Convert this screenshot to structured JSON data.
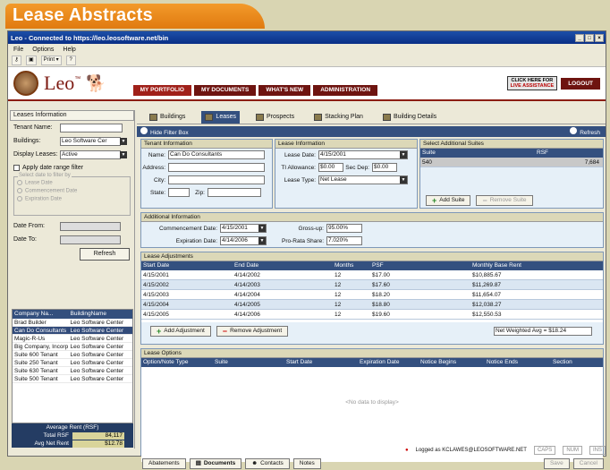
{
  "banner": {
    "title": "Lease Abstracts"
  },
  "window": {
    "title": "Leo - Connected to https://leo.leosoftware.net/bin"
  },
  "menu": [
    "File",
    "Options",
    "Help"
  ],
  "toolbar": {
    "print": "Print"
  },
  "header": {
    "logo": "Leo",
    "tm": "™",
    "nav": [
      "MY PORTFOLIO",
      "MY DOCUMENTS",
      "WHAT'S NEW",
      "ADMINISTRATION"
    ],
    "assist_line1": "CLICK HERE FOR",
    "assist_line2": "LIVE ASSISTANCE",
    "logout": "LOGOUT"
  },
  "left": {
    "title": "Leases Information",
    "tenant_label": "Tenant Name:",
    "tenant_value": "",
    "buildings_label": "Buildings:",
    "buildings_value": "Leo Software Cer",
    "display_label": "Display Leases:",
    "display_value": "Active",
    "apply_label": "Apply date range filter",
    "group_label": "Select date to filter by",
    "radios": [
      "Lease Date",
      "Commencement Date",
      "Expiration Date"
    ],
    "date_from": "Date From:",
    "date_to": "Date To:",
    "refresh": "Refresh",
    "table_headers": [
      "Company Na...",
      "BuildingName"
    ],
    "rows": [
      [
        "Brad Builder",
        "Leo Software Center"
      ],
      [
        "Can Do Consultants",
        "Leo Software Center"
      ],
      [
        "Magic-R-Us",
        "Leo Software Center"
      ],
      [
        "Big Company, Incorp",
        "Leo Software Center"
      ],
      [
        "Suite 600 Tenant",
        "Leo Software Center"
      ],
      [
        "Suite 250 Tenant",
        "Leo Software Center"
      ],
      [
        "Suite 630 Tenant",
        "Leo Software Center"
      ],
      [
        "Suite 500 Tenant",
        "Leo Software Center"
      ]
    ],
    "avg_title": "Average Rent (RSF)",
    "total_label": "Total RSF",
    "total_value": "84,117",
    "avg_label": "Avg Net Rent",
    "avg_value": "$12.78"
  },
  "tabs": [
    "Buildings",
    "Leases",
    "Prospects",
    "Stacking Plan",
    "Building Details"
  ],
  "filterbar": {
    "hide": "Hide Filter Box",
    "refresh": "Refresh"
  },
  "tenant_info": {
    "title": "Tenant Information",
    "name_label": "Name:",
    "name_value": "Can Do Consultants",
    "address_label": "Address:",
    "city_label": "City:",
    "state_label": "State:",
    "zip_label": "Zip:"
  },
  "lease_info": {
    "title": "Lease Information",
    "date_label": "Lease Date:",
    "date_value": "4/15/2001",
    "ti_label": "TI Allowance:",
    "ti_value": "$0.00",
    "sec_label": "Sec Dep:",
    "sec_value": "$0.00",
    "type_label": "Lease Type:",
    "type_value": "Net Lease"
  },
  "suites": {
    "title": "Select Additional Suites",
    "headers": [
      "Suite",
      "RSF"
    ],
    "rows": [
      [
        "540",
        "7,684"
      ]
    ],
    "add": "Add Suite",
    "remove": "Remove Suite"
  },
  "additional": {
    "title": "Additional Information",
    "comm_label": "Commencement Date:",
    "comm_value": "4/15/2001",
    "exp_label": "Expiration Date:",
    "exp_value": "4/14/2006",
    "gross_label": "Gross-up:",
    "gross_value": "95.00%",
    "prorata_label": "Pro-Rata Share:",
    "prorata_value": "7.020%"
  },
  "adjustments": {
    "title": "Lease Adjustments",
    "headers": [
      "Start Date",
      "End Date",
      "Months",
      "PSF",
      "Monthly Base Rent"
    ],
    "rows": [
      [
        "4/15/2001",
        "4/14/2002",
        "12",
        "$17.00",
        "$10,885.67"
      ],
      [
        "4/15/2002",
        "4/14/2003",
        "12",
        "$17.60",
        "$11,269.87"
      ],
      [
        "4/15/2003",
        "4/14/2004",
        "12",
        "$18.20",
        "$11,654.07"
      ],
      [
        "4/15/2004",
        "4/14/2005",
        "12",
        "$18.80",
        "$12,038.27"
      ],
      [
        "4/15/2005",
        "4/14/2006",
        "12",
        "$19.60",
        "$12,550.53"
      ]
    ],
    "add": "Add Adjustment",
    "remove": "Remove Adjustment",
    "weighted": "Net Weighted Avg = $18.24"
  },
  "options": {
    "title": "Lease Options",
    "headers": [
      "Option/Note Type",
      "Suite",
      "Start Date",
      "Expiration Date",
      "Notice Begins",
      "Notice Ends",
      "Section"
    ],
    "empty": "<No data to display>"
  },
  "bottom": {
    "abatements": "Abatements",
    "documents": "Documents",
    "contacts": "Contacts",
    "notes": "Notes",
    "save": "Save",
    "cancel": "Cancel"
  },
  "status": {
    "logged": "Logged as KCLAWES@LEOSOFTWARE.NET",
    "caps": "CAPS",
    "num": "NUM",
    "ins": "INS"
  }
}
